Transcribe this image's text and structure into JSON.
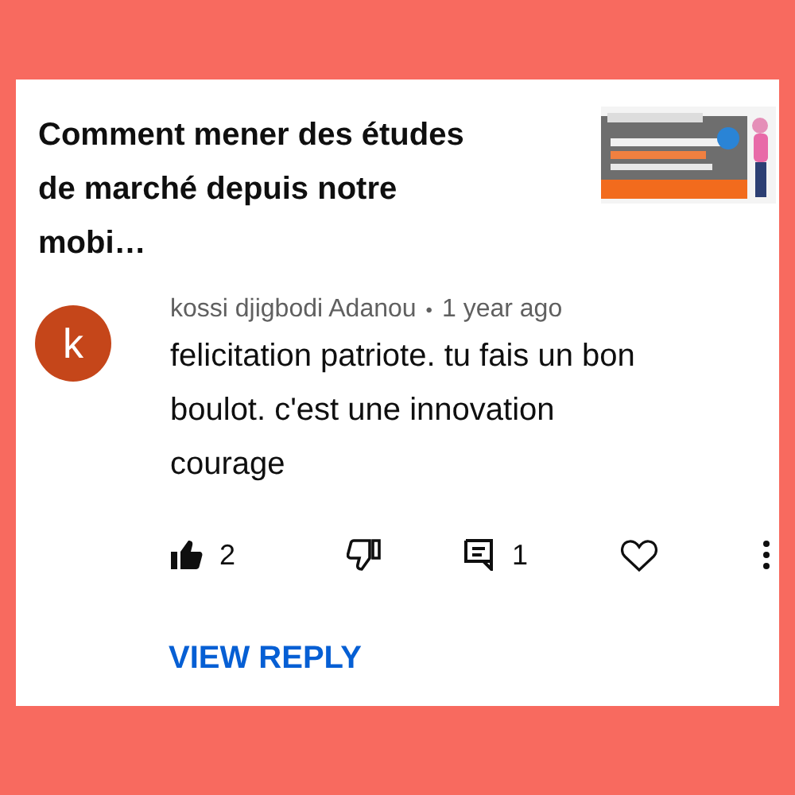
{
  "video": {
    "title": "Comment mener des études de marché depuis notre mobi…"
  },
  "comment": {
    "avatar_letter": "k",
    "author": "kossi djigbodi Adanou",
    "separator": "•",
    "time": "1 year ago",
    "text": "felicitation patriote. tu fais un bon boulot. c'est une innovation courage"
  },
  "actions": {
    "like": {
      "selected": true,
      "count": "2"
    },
    "dislike": {
      "selected": false
    },
    "replies": {
      "count": "1"
    },
    "heart": {
      "selected": false
    }
  },
  "view_reply": "VIEW REPLY"
}
